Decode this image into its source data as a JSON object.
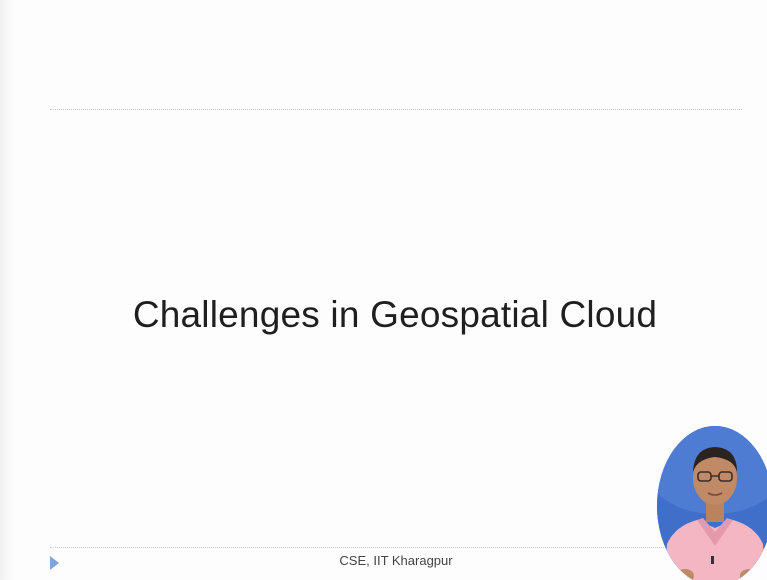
{
  "slide": {
    "title": "Challenges in Geospatial Cloud",
    "footer": "CSE, IIT Kharagpur"
  },
  "colors": {
    "background": "#fdfdfd",
    "title_text": "#1f1f1f",
    "footer_text": "#444444",
    "nav_arrow": "#7fa7d6",
    "presenter_backdrop": "#3f6fc9"
  },
  "icons": {
    "nav": "play-triangle-icon"
  }
}
